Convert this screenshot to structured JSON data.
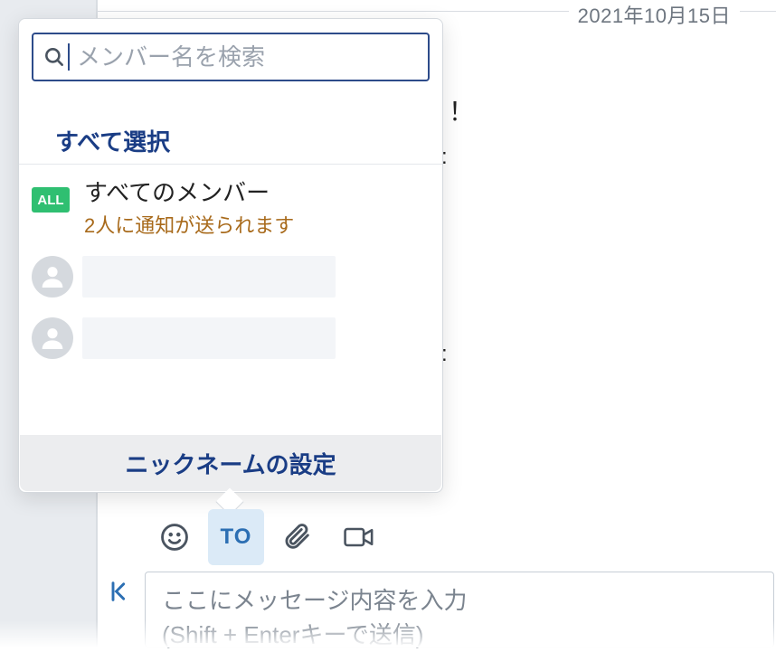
{
  "dateSeparator": "2021年10月15日",
  "bg": {
    "exclaim": "！",
    "colon": ":"
  },
  "popover": {
    "searchPlaceholder": "メンバー名を検索",
    "selectAll": "すべて選択",
    "allBadge": "ALL",
    "allMembersTitle": "すべてのメンバー",
    "allMembersSub": "2人に通知が送られます",
    "nicknameSetting": "ニックネームの設定"
  },
  "toolbar": {
    "to": "TO"
  },
  "composer": {
    "placeholder1": "ここにメッセージ内容を入力",
    "placeholder2": "(Shift + Enterキーで送信)"
  }
}
